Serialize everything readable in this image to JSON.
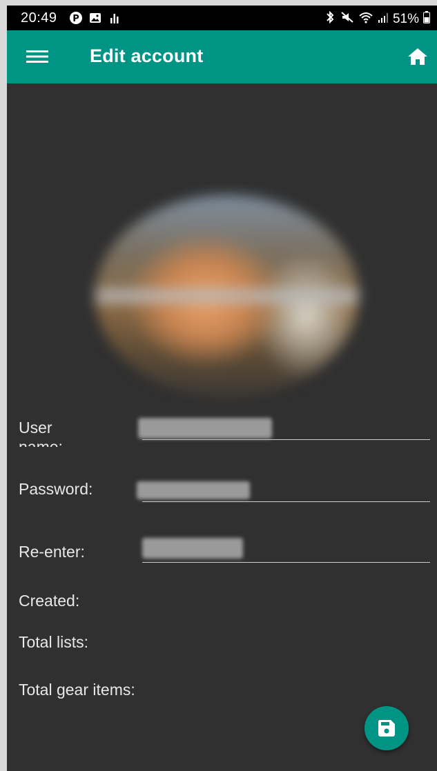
{
  "status_bar": {
    "time": "20:49",
    "battery": "51%",
    "left_icons": [
      "pinterest-icon",
      "image-icon",
      "signal-bars-icon"
    ],
    "right_icons": [
      "bluetooth-icon",
      "mute-icon",
      "wifi-icon",
      "cell-signal-icon",
      "battery-icon"
    ]
  },
  "app_bar": {
    "title": "Edit account",
    "menu_icon": "menu-icon",
    "home_icon": "home-icon",
    "color": "#009485"
  },
  "form": {
    "user_name_label": "User name:",
    "user_name_value": "",
    "password_label": "Password:",
    "password_value": "",
    "reenter_label": "Re-enter:",
    "reenter_value": ""
  },
  "info": {
    "created_label": "Created:",
    "created_value": "",
    "total_lists_label": "Total lists:",
    "total_lists_value": "",
    "total_gear_label": "Total gear items:",
    "total_gear_value": ""
  },
  "fab": {
    "icon": "save-icon",
    "color": "#009485"
  },
  "colors": {
    "background": "#303030",
    "accent": "#009485",
    "text": "#e8e8e8"
  }
}
